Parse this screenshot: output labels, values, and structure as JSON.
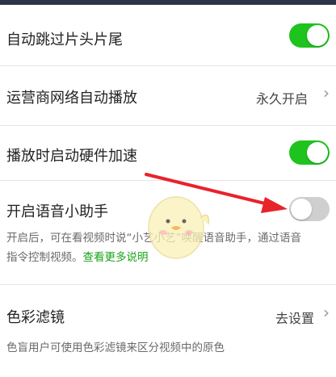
{
  "settings": {
    "skip_intro": {
      "label": "自动跳过片头片尾",
      "enabled": true
    },
    "carrier_autoplay": {
      "label": "运营商网络自动播放",
      "value": "永久开启",
      "chevron": "›"
    },
    "hw_accel": {
      "label": "播放时启动硬件加速",
      "enabled": true
    },
    "voice_assistant": {
      "label": "开启语音小助手",
      "enabled": false,
      "desc_line1": "开启后，可在看视频时说“小艺小艺”唤醒语音助手，通过语音",
      "desc_line2": "指令控制视频。",
      "link": "查看更多说明"
    },
    "color_filter": {
      "label": "色彩滤镜",
      "value": "去设置",
      "chevron": "›",
      "desc": "色盲用户可使用色彩滤镜来区分视频中的原色"
    }
  },
  "colors": {
    "toggle_on": "#1ec31e",
    "toggle_off": "#cfcfcf",
    "link": "#1aa31a",
    "arrow": "#e8232a"
  },
  "icons": {
    "arrow": "red-pointer-arrow",
    "mascot": "chick-mascot-watermark"
  }
}
